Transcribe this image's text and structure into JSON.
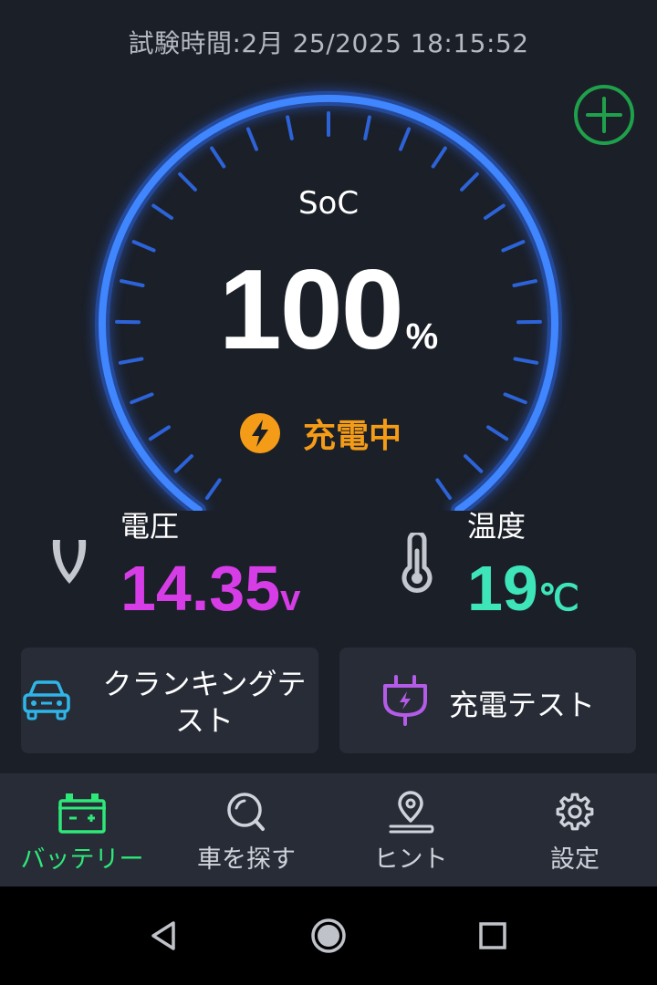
{
  "header": {
    "test_time_label": "試験時間:2月 25/2025 18:15:52"
  },
  "gauge": {
    "label": "SoC",
    "value": "100",
    "unit": "%",
    "level_percent": 100,
    "arc_color": "#2f6df5",
    "status_text": "充電中",
    "status_color": "#f49c17"
  },
  "metrics": {
    "voltage": {
      "label": "電圧",
      "value": "14.35",
      "unit": "v",
      "color": "#d63de6"
    },
    "temperature": {
      "label": "温度",
      "value": "19",
      "unit": "℃",
      "color": "#3ee5b9"
    }
  },
  "actions": {
    "cranking_test": {
      "label_line1": "クランキングテ",
      "label_line2": "スト",
      "icon": "car-icon"
    },
    "charging_test": {
      "label": "充電テスト",
      "icon": "plug-icon"
    }
  },
  "nav": {
    "items": [
      {
        "label": "バッテリー",
        "icon": "battery-icon",
        "active": true
      },
      {
        "label": "車を探す",
        "icon": "search-icon",
        "active": false
      },
      {
        "label": "ヒント",
        "icon": "location-pin-icon",
        "active": false
      },
      {
        "label": "設定",
        "icon": "gear-icon",
        "active": false
      }
    ],
    "active_color": "#2ee878"
  },
  "system_bar": {
    "buttons": [
      "back-icon",
      "home-icon",
      "recents-icon"
    ]
  }
}
